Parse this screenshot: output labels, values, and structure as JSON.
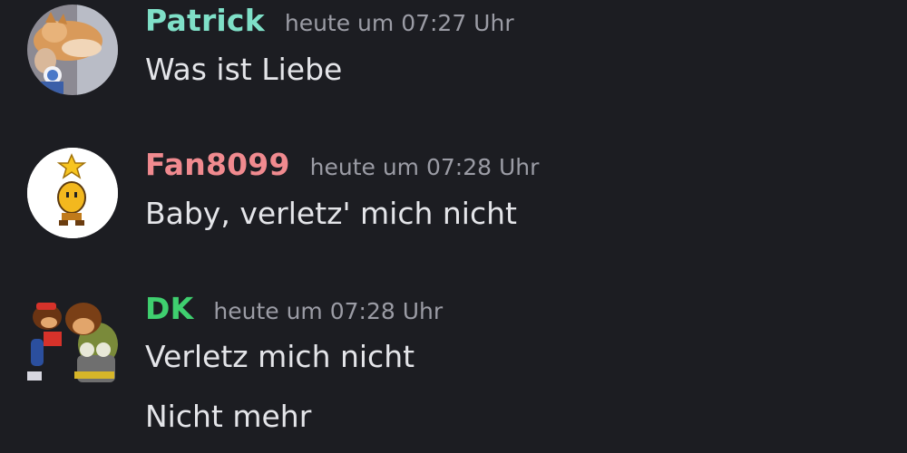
{
  "messages": [
    {
      "username": "Patrick",
      "username_color": "#7fe0c8",
      "timestamp": "heute um 07:27 Uhr",
      "avatar_icon": "cat-photo-avatar",
      "lines": [
        "Was ist Liebe"
      ]
    },
    {
      "username": "Fan8099",
      "username_color": "#f08a8f",
      "timestamp": "heute um 07:28 Uhr",
      "avatar_icon": "pixel-star-sprite-avatar",
      "lines": [
        "Baby, verletz' mich nicht"
      ]
    },
    {
      "username": "DK",
      "username_color": "#3fcf6f",
      "timestamp": "heute um 07:28 Uhr",
      "avatar_icon": "donkey-kong-avatar",
      "lines": [
        "Verletz mich nicht",
        "Nicht mehr"
      ]
    }
  ]
}
